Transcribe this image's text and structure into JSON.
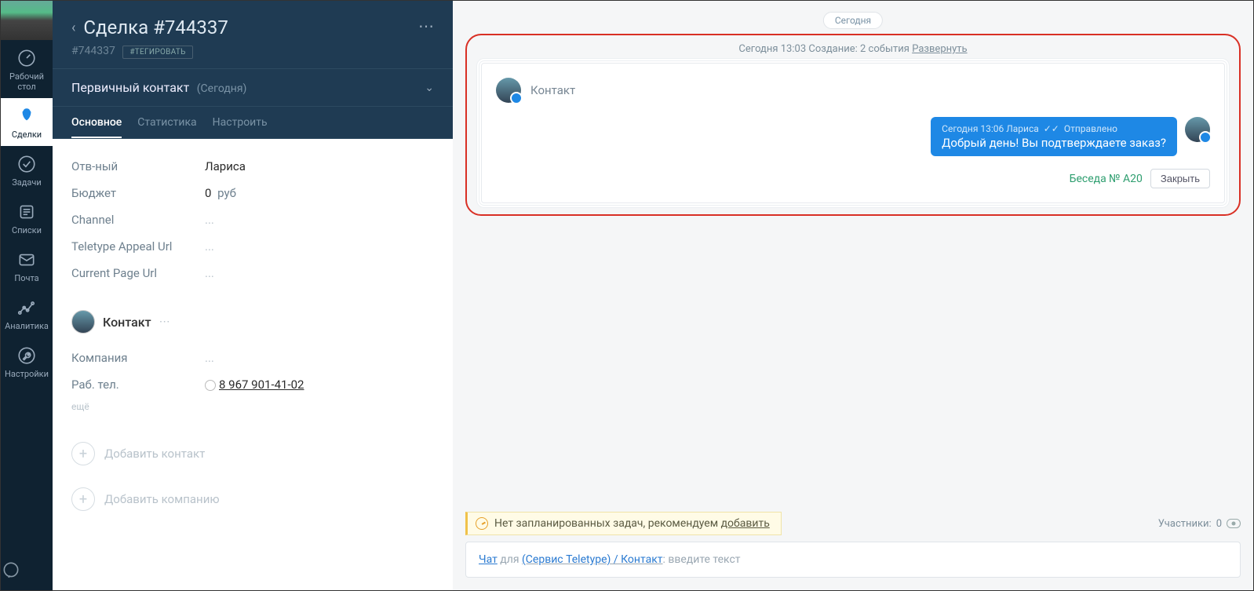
{
  "rail": {
    "items": [
      {
        "label": "Рабочий стол"
      },
      {
        "label": "Сделки"
      },
      {
        "label": "Задачи"
      },
      {
        "label": "Списки"
      },
      {
        "label": "Почта"
      },
      {
        "label": "Аналитика"
      },
      {
        "label": "Настройки"
      }
    ]
  },
  "deal": {
    "title": "Сделка #744337",
    "id": "#744337",
    "tag_button": "#ТЕГИРОВАТЬ",
    "stage": "Первичный контакт",
    "stage_date": "(Сегодня)",
    "tabs": [
      {
        "label": "Основное"
      },
      {
        "label": "Статистика"
      },
      {
        "label": "Настроить"
      }
    ],
    "fields": {
      "responsible": {
        "label": "Отв-ный",
        "value": "Лариса"
      },
      "budget": {
        "label": "Бюджет",
        "value": "0",
        "suffix": "руб"
      },
      "channel": {
        "label": "Channel",
        "value": "..."
      },
      "teletype": {
        "label": "Teletype Appeal Url",
        "value": "..."
      },
      "page_url": {
        "label": "Current Page Url",
        "value": "..."
      }
    },
    "contact": {
      "name": "Контакт",
      "company_label": "Компания",
      "company_value": "...",
      "phone_label": "Раб. тел.",
      "phone_value": "8 967 901-41-02",
      "more": "ещё"
    },
    "add_contact": "Добавить контакт",
    "add_company": "Добавить компанию"
  },
  "main": {
    "today": "Сегодня",
    "event_line": {
      "time": "Сегодня 13:03",
      "text": "Создание: 2 события",
      "expand": "Развернуть"
    },
    "incoming": {
      "name": "Контакт"
    },
    "outgoing": {
      "meta_time": "Сегодня 13:06",
      "meta_author": "Лариса",
      "meta_status": "Отправлено",
      "text": "Добрый день! Вы подтверждаете заказ?"
    },
    "conversation_label": "Беседа № A20",
    "close": "Закрыть",
    "no_task": {
      "text": "Нет запланированных задач, рекомендуем ",
      "add": "добавить"
    },
    "participants": {
      "label": "Участники:",
      "count": "0"
    },
    "composer": {
      "chat": "Чат",
      "for": " для ",
      "service": "(Сервис Teletype) / Контакт",
      "placeholder": ": введите текст"
    }
  }
}
